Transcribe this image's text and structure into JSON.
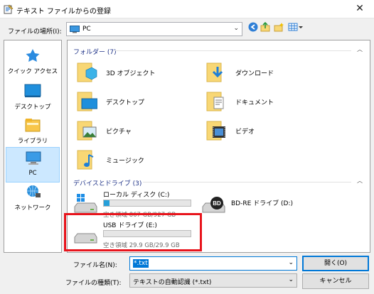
{
  "window": {
    "title": "テキスト ファイルからの登録",
    "close_glyph": "✕"
  },
  "location": {
    "label": "ファイルの場所(I):",
    "value": "PC"
  },
  "places": [
    {
      "label": "クイック アクセス",
      "icon": "star-icon"
    },
    {
      "label": "デスクトップ",
      "icon": "desktop-icon"
    },
    {
      "label": "ライブラリ",
      "icon": "library-icon"
    },
    {
      "label": "PC",
      "icon": "pc-icon",
      "selected": true
    },
    {
      "label": "ネットワーク",
      "icon": "network-icon"
    }
  ],
  "folders": {
    "header": "フォルダー (7)",
    "items": [
      {
        "label": "3D オブジェクト",
        "icon": "3d-objects-folder-icon"
      },
      {
        "label": "ダウンロード",
        "icon": "downloads-folder-icon"
      },
      {
        "label": "デスクトップ",
        "icon": "desktop-folder-icon"
      },
      {
        "label": "ドキュメント",
        "icon": "documents-folder-icon"
      },
      {
        "label": "ピクチャ",
        "icon": "pictures-folder-icon"
      },
      {
        "label": "ビデオ",
        "icon": "videos-folder-icon"
      },
      {
        "label": "ミュージック",
        "icon": "music-folder-icon"
      }
    ]
  },
  "devices": {
    "header": "デバイスとドライブ (3)",
    "items": [
      {
        "label": "ローカル ディスク (C:)",
        "free": "空き領域 867 GB/927 GB",
        "used_fraction": 0.065,
        "icon": "windows-drive-icon"
      },
      {
        "label": "BD-RE ドライブ (D:)",
        "icon": "bd-drive-icon",
        "badge": "BD"
      },
      {
        "label": "USB ドライブ (E:)",
        "free": "空き領域 29.9 GB/29.9 GB",
        "used_fraction": 0.0,
        "icon": "usb-drive-icon"
      }
    ]
  },
  "filename": {
    "label": "ファイル名(N):",
    "value": "*.txt"
  },
  "filetype": {
    "label": "ファイルの種類(T):",
    "value": "テキストの自動認識 (*.txt)"
  },
  "buttons": {
    "open": "開く(O)",
    "cancel": "キャンセル"
  },
  "colors": {
    "accent": "#0078d7",
    "highlight": "#e8141c",
    "folder": "#f8d775",
    "bar_fill": "#26a0da"
  }
}
